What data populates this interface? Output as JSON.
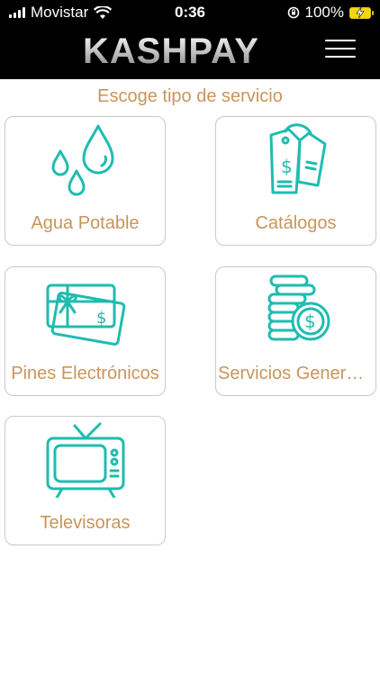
{
  "status_bar": {
    "carrier": "Movistar",
    "time": "0:36",
    "battery": "100%"
  },
  "header": {
    "logo": "KASHPAY"
  },
  "main": {
    "prompt": "Escoge tipo de servicio",
    "cards": [
      {
        "label": "Agua Potable",
        "icon": "water-drops-icon"
      },
      {
        "label": "Catálogos",
        "icon": "price-tags-icon"
      },
      {
        "label": "Pines Electrónicos",
        "icon": "gift-card-icon"
      },
      {
        "label": "Servicios Generales",
        "icon": "coins-icon"
      },
      {
        "label": "Televisoras",
        "icon": "television-icon"
      }
    ]
  },
  "colors": {
    "accent": "#c9955a",
    "icon_teal": "#1fbcb0",
    "header_bg": "#000000"
  }
}
